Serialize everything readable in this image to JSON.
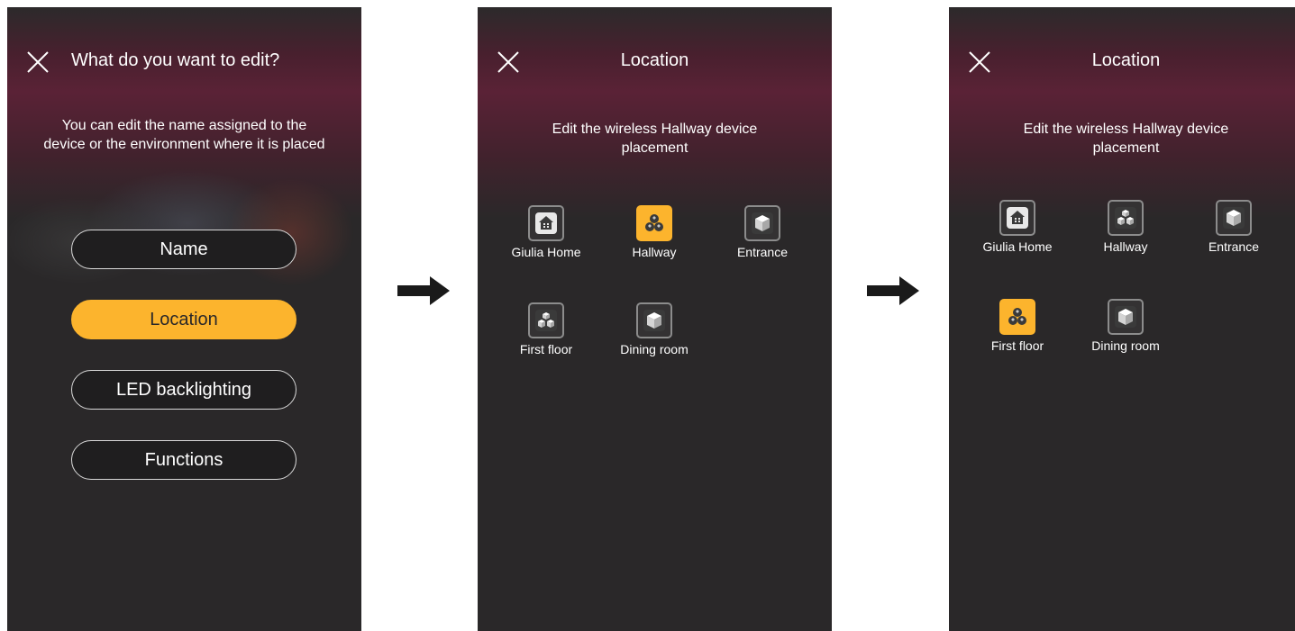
{
  "screen1": {
    "title": "What do you want to edit?",
    "subtitle": [
      "You can edit the name assigned to the",
      "device or the environment where it is placed"
    ],
    "buttons": [
      {
        "label": "Name",
        "active": false
      },
      {
        "label": "Location",
        "active": true
      },
      {
        "label": "LED backlighting",
        "active": false
      },
      {
        "label": "Functions",
        "active": false
      }
    ]
  },
  "screen2": {
    "title": "Location",
    "subtitle": [
      "Edit the wireless Hallway device",
      "placement"
    ],
    "locations": [
      {
        "label": "Giulia Home",
        "icon": "home-icon",
        "selected": false
      },
      {
        "label": "Hallway",
        "icon": "cubes-icon",
        "selected": true
      },
      {
        "label": "Entrance",
        "icon": "cube-icon",
        "selected": false
      },
      {
        "label": "First floor",
        "icon": "cubes-icon",
        "selected": false
      },
      {
        "label": "Dining room",
        "icon": "cube-icon",
        "selected": false
      }
    ]
  },
  "screen3": {
    "title": "Location",
    "subtitle": [
      "Edit the wireless Hallway device",
      "placement"
    ],
    "locations": [
      {
        "label": "Giulia Home",
        "icon": "home-icon",
        "selected": false
      },
      {
        "label": "Hallway",
        "icon": "cubes-icon",
        "selected": false
      },
      {
        "label": "Entrance",
        "icon": "cube-icon",
        "selected": false
      },
      {
        "label": "First floor",
        "icon": "cubes-icon",
        "selected": true
      },
      {
        "label": "Dining room",
        "icon": "cube-icon",
        "selected": false
      }
    ]
  },
  "colors": {
    "accent": "#fcb42d",
    "background": "#2a2829",
    "gradient": "#5a2236"
  }
}
